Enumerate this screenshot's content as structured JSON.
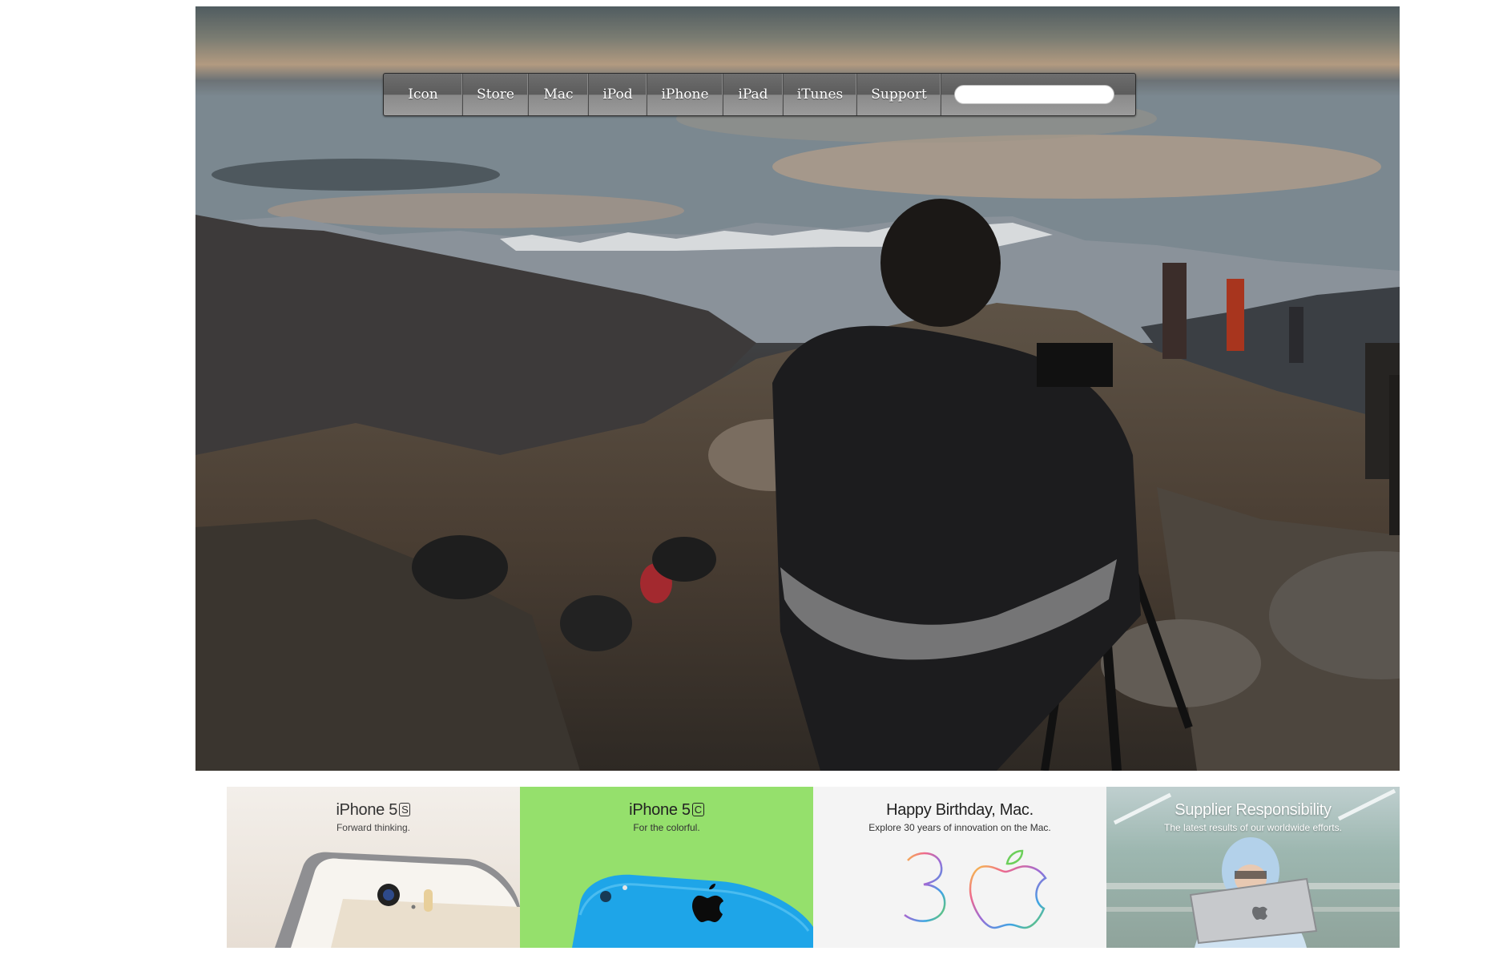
{
  "nav": {
    "items": [
      "Icon",
      "Store",
      "Mac",
      "iPod",
      "iPhone",
      "iPad",
      "iTunes",
      "Support"
    ],
    "search_value": ""
  },
  "promos": [
    {
      "title": "iPhone 5",
      "badge": "S",
      "subtitle": "Forward thinking.",
      "bg": "#f1ece6"
    },
    {
      "title": "iPhone 5",
      "badge": "C",
      "subtitle": "For the colorful.",
      "bg": "#95e06c"
    },
    {
      "title": "Happy Birthday, Mac.",
      "subtitle": "Explore 30 years of innovation on the Mac.",
      "bg": "#f4f4f4"
    },
    {
      "title": "Supplier Responsibility",
      "subtitle": "The latest results of our worldwide efforts.",
      "bg": "#a7bcbf"
    }
  ],
  "colors": {
    "iphone5c_blue": "#1ea5e8",
    "nav_text": "#ffffff"
  }
}
